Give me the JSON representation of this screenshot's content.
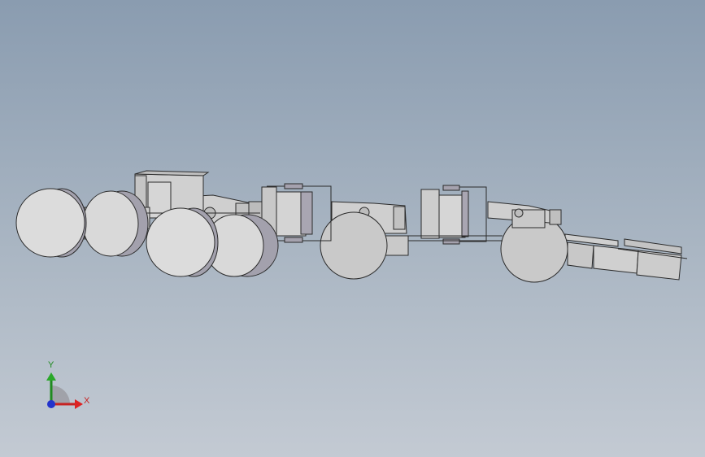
{
  "view": {
    "type": "cad-3d-viewport",
    "background_top": "#8a9cb0",
    "background_bottom": "#c3cad3",
    "model_color": "#d9d9d9",
    "model_edge_color": "#2b2b2b",
    "model_shadow_color": "#a3a1ad"
  },
  "triad": {
    "y_label": "Y",
    "x_label": "X",
    "y_color": "#1f8a1f",
    "x_color": "#c62222",
    "z_color": "#2233cc"
  }
}
